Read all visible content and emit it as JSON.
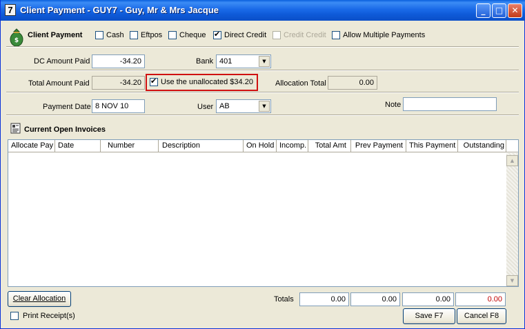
{
  "window": {
    "icon_text": "7",
    "title": "Client Payment - GUY7 - Guy, Mr & Mrs Jacque",
    "buttons": {
      "minimize": "_",
      "maximize": "□",
      "close": "✕"
    }
  },
  "header": {
    "section_label": "Client Payment",
    "options": [
      {
        "label": "Cash",
        "checked": false,
        "enabled": true
      },
      {
        "label": "Eftpos",
        "checked": false,
        "enabled": true
      },
      {
        "label": "Cheque",
        "checked": false,
        "enabled": true
      },
      {
        "label": "Direct Credit",
        "checked": true,
        "enabled": true
      },
      {
        "label": "Credit Credit",
        "checked": false,
        "enabled": false
      },
      {
        "label": "Allow Multiple Payments",
        "checked": false,
        "enabled": true
      }
    ]
  },
  "form": {
    "dc_amount_label": "DC Amount Paid",
    "dc_amount_value": "-34.20",
    "bank_label": "Bank",
    "bank_value": "401",
    "total_amount_label": "Total Amount Paid",
    "total_amount_value": "-34.20",
    "use_unallocated_label": "Use the unallocated $34.20",
    "use_unallocated_checked": true,
    "allocation_total_label": "Allocation Total",
    "allocation_total_value": "0.00",
    "payment_date_label": "Payment Date",
    "payment_date_value": "8 NOV 10",
    "user_label": "User",
    "user_value": "AB",
    "note_label": "Note",
    "note_value": ""
  },
  "invoices": {
    "section_label": "Current Open Invoices",
    "columns": [
      "Allocate Pay",
      "Date",
      "Number",
      "Description",
      "On Hold",
      "Incomp.",
      "Total Amt",
      "Prev Payment",
      "This Payment",
      "Outstanding"
    ],
    "rows": []
  },
  "footer": {
    "clear_allocation": "Clear Allocation",
    "totals_label": "Totals",
    "totals": [
      "0.00",
      "0.00",
      "0.00",
      "0.00"
    ],
    "outstanding_color": "#c00000",
    "print_receipts_label": "Print Receipt(s)",
    "print_receipts_checked": false,
    "save_button": "Save F7",
    "cancel_button": "Cancel F8"
  }
}
